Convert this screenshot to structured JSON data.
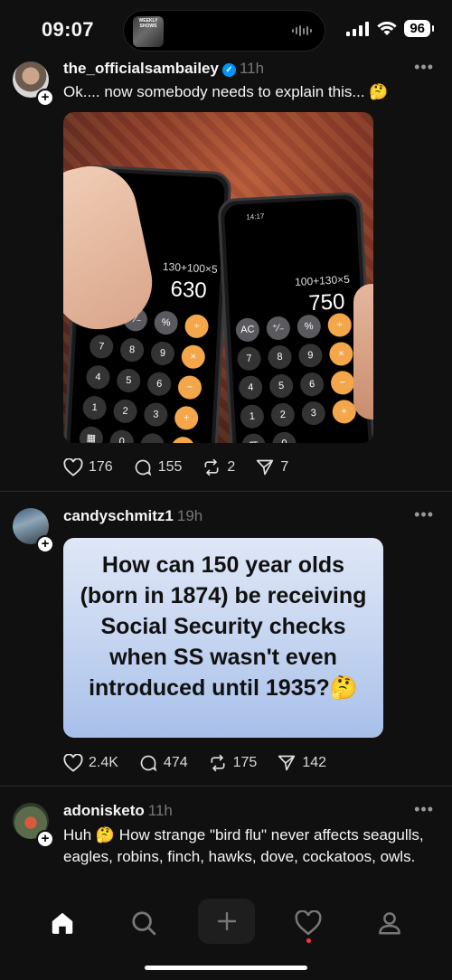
{
  "status_bar": {
    "time": "09:07",
    "battery": "96",
    "now_playing_thumb_text": "WEEKLY SHOWS"
  },
  "posts": [
    {
      "username": "the_officialsambailey",
      "verified": true,
      "time_ago": "11h",
      "text": "Ok.... now somebody needs to explain this... 🤔",
      "media": {
        "type": "photo",
        "left_phone": {
          "expression": "130+100×5",
          "result": "630"
        },
        "right_phone": {
          "expression": "100+130×5",
          "result": "750",
          "clock": "14:17"
        }
      },
      "likes": "176",
      "replies": "155",
      "reposts": "2",
      "shares": "7"
    },
    {
      "username": "candyschmitz1",
      "verified": false,
      "time_ago": "19h",
      "media": {
        "type": "text-card",
        "text": "How can 150 year olds (born in 1874) be receiving Social Security checks when SS wasn't even introduced until 1935?🤔"
      },
      "likes": "2.4K",
      "replies": "474",
      "reposts": "175",
      "shares": "142"
    },
    {
      "username": "adonisketo",
      "verified": false,
      "time_ago": "11h",
      "text": "Huh 🤔 How strange \"bird flu\" never affects seagulls, eagles, robins, finch, hawks, dove, cockatoos, owls."
    }
  ],
  "more_glyph": "•••",
  "plus_glyph": "+",
  "colors": {
    "background": "#101010",
    "verified_blue": "#0095f6",
    "calc_orange": "#f4a64a",
    "notification_red": "#ff3040"
  },
  "bottom_nav": {
    "items": [
      "home-icon",
      "search-icon",
      "create-icon",
      "activity-heart-icon",
      "profile-icon"
    ],
    "active": "home-icon",
    "activity_has_notification": true
  }
}
